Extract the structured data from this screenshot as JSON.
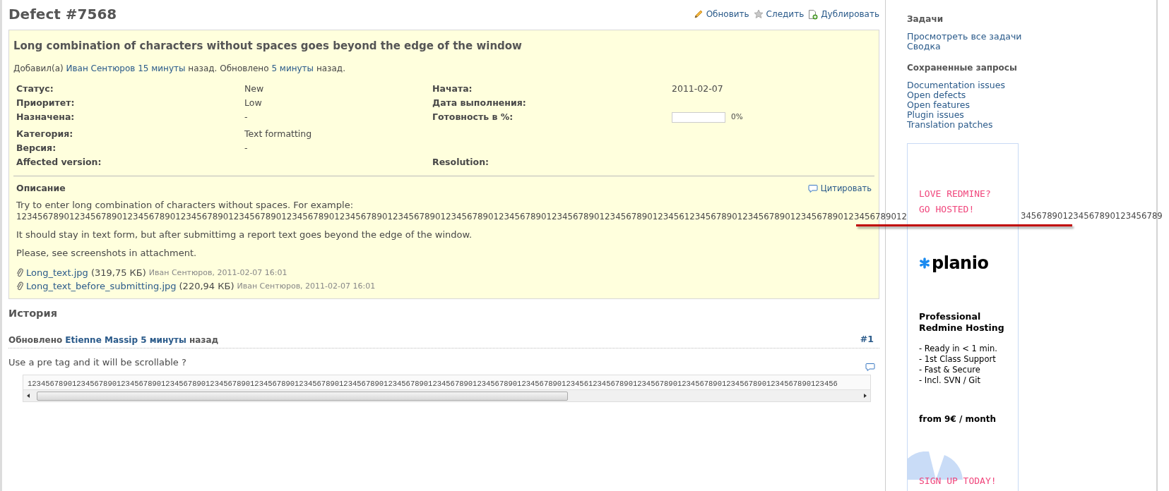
{
  "issue": {
    "title": "Defect #7568",
    "actions": [
      {
        "kind": "edit",
        "label": "Обновить"
      },
      {
        "kind": "watch",
        "label": "Следить"
      },
      {
        "kind": "copy",
        "label": "Дублировать"
      }
    ]
  },
  "details": {
    "subject": "Long combination of characters without spaces goes beyond the edge of the window",
    "author_line": [
      {
        "kind": "text",
        "text": "Добавил(а) "
      },
      {
        "kind": "link",
        "text": "Иван Сентюров"
      },
      {
        "kind": "link",
        "text": "15 минуты"
      },
      {
        "kind": "text",
        "text": " назад. Обновлено "
      },
      {
        "kind": "link",
        "text": "5 минуты"
      },
      {
        "kind": "text",
        "text": " назад."
      }
    ],
    "attributes": [
      {
        "left": {
          "label": "Статус:",
          "value": "New"
        },
        "right": {
          "label": "Начата:",
          "value": "2011-02-07"
        }
      },
      {
        "left": {
          "label": "Приоритет:",
          "value": "Low"
        },
        "right": {
          "label": "Дата выполнения:"
        }
      },
      {
        "left": {
          "label": "Назначена:",
          "value": "-"
        },
        "right": {
          "label": "Готовность в %:",
          "kind": "progress",
          "level": 0,
          "reading": "0%"
        }
      },
      {
        "left": {
          "label": "Категория:",
          "value": "Text formatting"
        }
      },
      {
        "left": {
          "label": "Версия:",
          "value": "-"
        }
      },
      {
        "left": {
          "label": "Affected version:"
        },
        "right": {
          "label": "Resolution:"
        }
      }
    ],
    "description": {
      "heading": "Описание",
      "quote": "Цитировать",
      "intro": "Try to enter long combination of characters without spaces. For example:",
      "long_number_start": "123456789012345678901234567890123456789012345678901234567890123456789012345678901234567890123456789012345678901234567890123456123456789012345678901234567890123456789012",
      "long_number_end": "345678901234567890123456789",
      "paragraphs": [
        "It should stay in text form, but after submittimg a report text goes beyond the edge of the window.",
        "Please, see screenshots in attachment."
      ]
    },
    "attachments": [
      {
        "name": "Long_text.jpg",
        "size": "(319,75 КБ)",
        "meta": "Иван Сентюров, 2011-02-07 16:01"
      },
      {
        "name": "Long_text_before_submitting.jpg",
        "size": "(220,94 КБ)",
        "meta": "Иван Сентюров, 2011-02-07 16:01"
      }
    ]
  },
  "history": {
    "heading": "История",
    "journals": [
      {
        "header": [
          {
            "kind": "text",
            "text": "Обновлено "
          },
          {
            "kind": "link",
            "text": "Etienne Massip"
          },
          {
            "kind": "link",
            "text": "5 минуты"
          },
          {
            "kind": "text",
            "text": " назад"
          }
        ],
        "number": "#1",
        "comment": "Use a pre tag and it will be scrollable ?",
        "pre": "12345678901234567890123456789012345678901234567890123456789012345678901234567890123456789012345678901234567890123456789012345612345678901234567890123456789012345678901234567890123456"
      }
    ]
  },
  "sidebar": {
    "sections": [
      {
        "heading": "Задачи",
        "links": [
          "Просмотреть все задачи",
          "Сводка"
        ]
      },
      {
        "heading": "Сохраненные запросы",
        "links": [
          "Documentation issues",
          "Open defects",
          "Open features",
          "Plugin issues",
          "Translation patches"
        ]
      }
    ],
    "ad": {
      "tagline": [
        "LOVE REDMINE?",
        "GO HOSTED!"
      ],
      "logo": "planio",
      "headline": [
        "Professional",
        "Redmine Hosting"
      ],
      "bullets": [
        "- Ready in < 1 min.",
        "- 1st Class Support",
        "- Fast & Secure",
        "- Incl. SVN / Git"
      ],
      "price": "from 9€ / month",
      "cta": "SIGN UP TODAY!"
    }
  }
}
